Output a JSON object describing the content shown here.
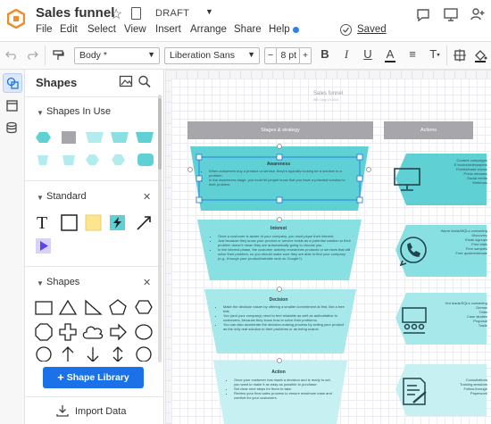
{
  "header": {
    "title": "Sales funnel",
    "status": "DRAFT",
    "saved_label": "Saved",
    "menu": [
      "File",
      "Edit",
      "Select",
      "View",
      "Insert",
      "Arrange",
      "Share",
      "Help"
    ]
  },
  "toolbar": {
    "style_select": "Body *",
    "font_select": "Liberation Sans",
    "font_size": "8 pt",
    "minus": "−",
    "plus": "+",
    "bold": "B",
    "italic": "I",
    "underline": "U",
    "text_color": "A",
    "align": "≡",
    "text_format": "T"
  },
  "sidebar": {
    "heading": "Shapes",
    "sections": [
      {
        "title": "Shapes In Use"
      },
      {
        "title": "Standard"
      },
      {
        "title": "Shapes"
      }
    ],
    "library_button": "Shape Library",
    "import_label": "Import Data"
  },
  "canvas": {
    "doc_title": "Sales funnel",
    "doc_subtitle": "WB  |  July 19 2021",
    "col_stages": "Stages & strategy",
    "col_actions": "Actions",
    "stages": [
      {
        "title": "Awareness",
        "bullets": [
          "When customers buy a product or service, they're typically looking for a solution to a problem.",
          "In the awareness stage, you must let people know that you have a potential solution to their problem."
        ],
        "actions": "Content campaigns\nE-books/whitepapers\nEvents/trade shows\nPress releases\nSocial media\nWebinars"
      },
      {
        "title": "Interest",
        "bullets": [
          "Once a customer is aware of your company, you must pique their interest.",
          "Just because they know your product or service exists as a potential solution to their problem doesn't mean they are automatically going to choose you.",
          "In the interest phase, the customer actively researches products or services that will solve their problem, so you should make sure they are able to find your company (e.g., through your product/website rank on Google?)."
        ],
        "actions": "Warm leads/MQLs contacting\nDiscovery\nEmail signups\nFree trials\nFree samples\nFree quote/estimate"
      },
      {
        "title": "Decision",
        "bullets": [
          "Make the decision easier by offering a smaller commitment at first, like a free trial.",
          "You (and your company) need to feel relatable as well as authoritative to customers, because they know how to solve their problems.",
          "You can also accelerate the decision-making process by selling your product as the only real solution to their problems or as being scarce."
        ],
        "actions": "Hot leads/SQLs contacting\nDemos\nTrials\nCase studies\nProposal\nTrade"
      },
      {
        "title": "Action",
        "bullets": [
          "Once your customer has made a decision and is ready to act, you want to make it as easy as possible to purchase.",
          "Set clear next steps for them to take.",
          "Review your final sales process to ensure maximum ease and comfort for your customers."
        ],
        "actions": "Consultations\nTraining sessions\nFollow-through\nPaperwork"
      }
    ]
  },
  "colors": {
    "accent": "#1b72e8",
    "teal": "#5fd0d4",
    "teal_light": "#b2ecee",
    "grey_header": "#a7a7ab"
  }
}
